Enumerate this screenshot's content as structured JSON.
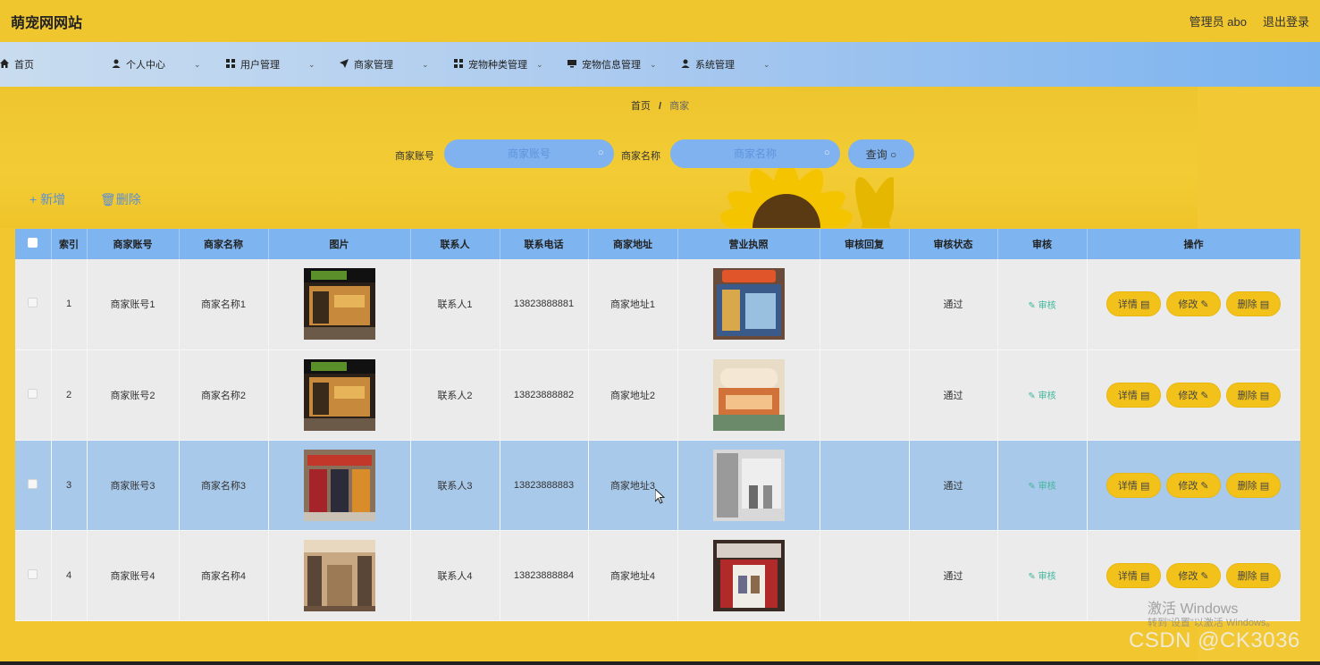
{
  "header": {
    "title": "萌宠网网站",
    "user": "管理员 abo",
    "logout": "退出登录"
  },
  "nav": {
    "items": [
      {
        "label": "首页",
        "icon": "home-icon"
      },
      {
        "label": "个人中心",
        "icon": "user-icon"
      },
      {
        "label": "用户管理",
        "icon": "grid-icon"
      },
      {
        "label": "商家管理",
        "icon": "send-icon"
      },
      {
        "label": "宠物种类管理",
        "icon": "grid-icon"
      },
      {
        "label": "宠物信息管理",
        "icon": "monitor-icon"
      },
      {
        "label": "系统管理",
        "icon": "user-icon"
      }
    ]
  },
  "breadcrumb": {
    "home": "首页",
    "sep": "/",
    "current": "商家"
  },
  "search": {
    "account_label": "商家账号",
    "account_placeholder": "商家账号",
    "name_label": "商家名称",
    "name_placeholder": "商家名称",
    "button": "查询"
  },
  "actions": {
    "add": "新增",
    "delete": "删除"
  },
  "table": {
    "headers": [
      "索引",
      "商家账号",
      "商家名称",
      "图片",
      "联系人",
      "联系电话",
      "商家地址",
      "营业执照",
      "审核回复",
      "审核状态",
      "审核",
      "操作"
    ],
    "rows": [
      {
        "index": "1",
        "account": "商家账号1",
        "name": "商家名称1",
        "contact": "联系人1",
        "phone": "13823888881",
        "address": "商家地址1",
        "reply": "",
        "status": "通过",
        "audit": "审核"
      },
      {
        "index": "2",
        "account": "商家账号2",
        "name": "商家名称2",
        "contact": "联系人2",
        "phone": "13823888882",
        "address": "商家地址2",
        "reply": "",
        "status": "通过",
        "audit": "审核"
      },
      {
        "index": "3",
        "account": "商家账号3",
        "name": "商家名称3",
        "contact": "联系人3",
        "phone": "13823888883",
        "address": "商家地址3",
        "reply": "",
        "status": "通过",
        "audit": "审核"
      },
      {
        "index": "4",
        "account": "商家账号4",
        "name": "商家名称4",
        "contact": "联系人4",
        "phone": "13823888884",
        "address": "商家地址4",
        "reply": "",
        "status": "通过",
        "audit": "审核"
      }
    ],
    "op_labels": {
      "detail": "详情",
      "edit": "修改",
      "delete": "删除"
    }
  },
  "watermark": {
    "activate": "激活 Windows",
    "activate_hint": "转到\"设置\"以激活 Windows。",
    "csdn": "CSDN @CK3036"
  },
  "colors": {
    "header_bg": "#f0c62e",
    "nav_gradient_end": "#7bb3ef",
    "table_header_bg": "#7eb4ef",
    "op_button": "#f3c21a",
    "audit_link": "#3fb79b"
  }
}
